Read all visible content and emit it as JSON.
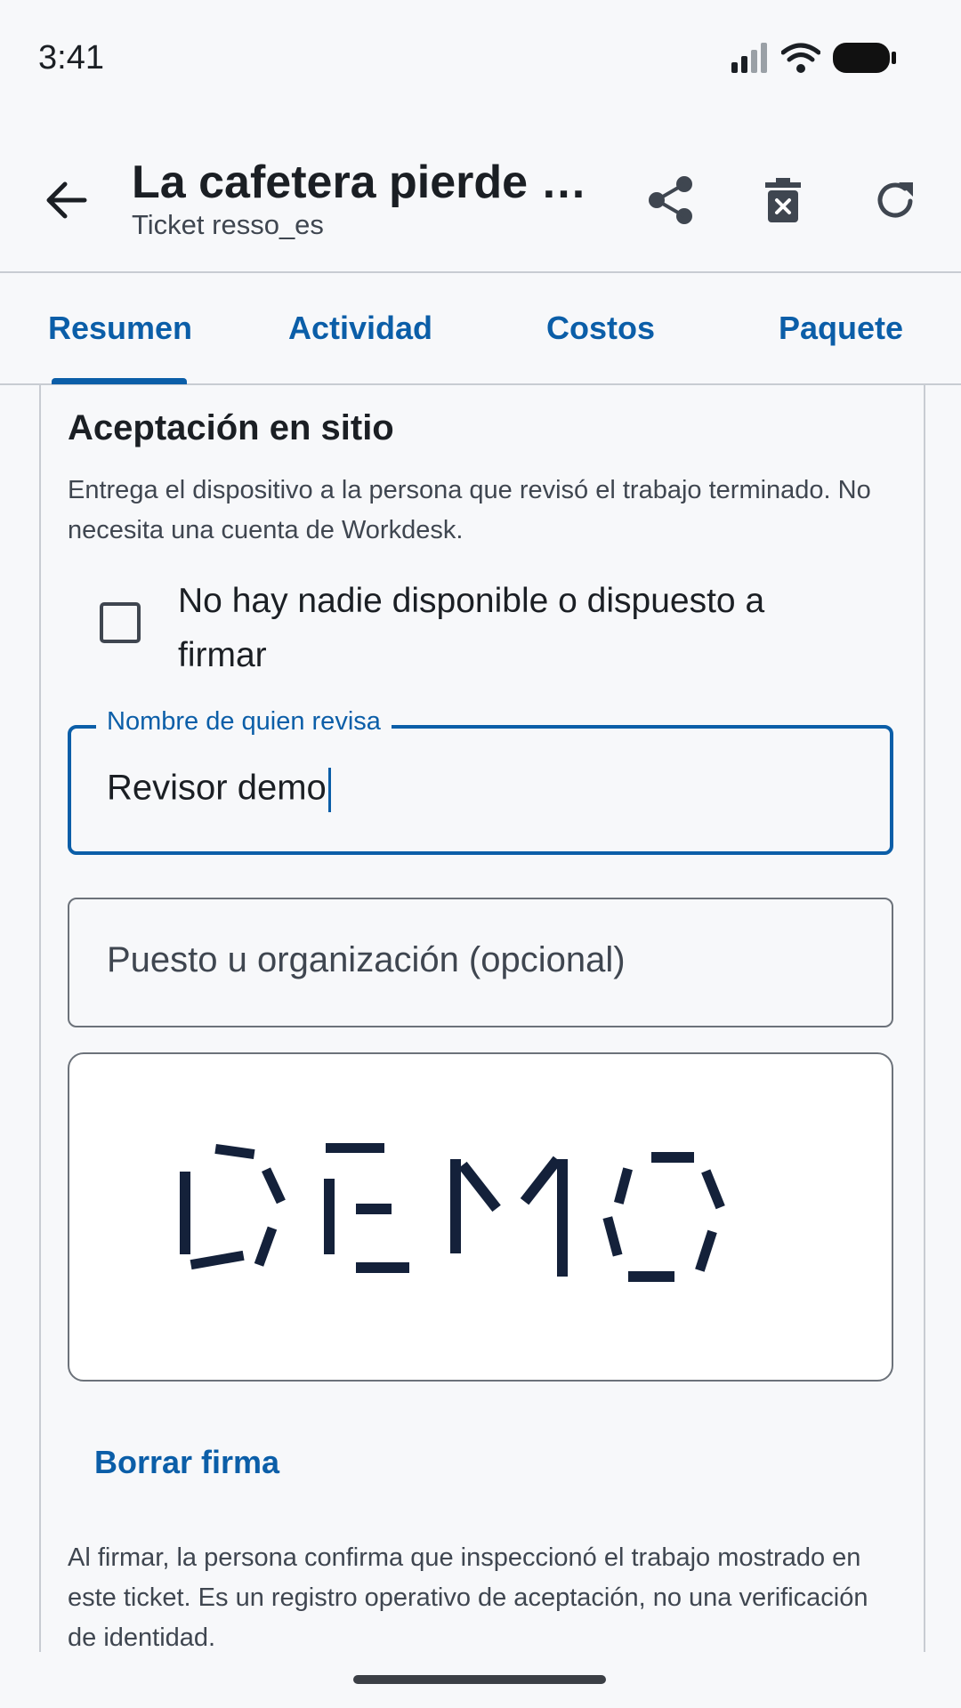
{
  "status_bar": {
    "time": "3:41",
    "icons": [
      "signal-icon",
      "wifi-icon",
      "battery-icon"
    ]
  },
  "app_bar": {
    "title": "La cafetera pierde pr…",
    "subtitle": "Ticket resso_es",
    "actions": [
      "share-icon",
      "delete-icon",
      "refresh-icon"
    ]
  },
  "tabs": [
    {
      "label": "Resumen",
      "selected": true
    },
    {
      "label": "Actividad",
      "selected": false
    },
    {
      "label": "Costos",
      "selected": false
    },
    {
      "label": "Paquete",
      "selected": false
    }
  ],
  "section": {
    "title": "Aceptación en sitio",
    "description": "Entrega el dispositivo a la persona que revisó el trabajo terminado. No necesita una cuenta de Workdesk.",
    "checkbox_label": "No hay nadie disponible o dispuesto a firmar",
    "checkbox_checked": false,
    "reviewer_field": {
      "label": "Nombre de quien revisa",
      "value": "Revisor demo"
    },
    "role_field": {
      "placeholder": "Puesto u organización (opcional)",
      "value": ""
    },
    "signature": {
      "text": "DEMO"
    },
    "clear_label": "Borrar firma",
    "disclaimer": "Al firmar, la persona confirma que inspeccionó el trabajo mostrado en este ticket. Es un registro operativo de aceptación, no una verificación de identidad."
  },
  "colors": {
    "accent": "#0b5ea8",
    "text": "#1b1f24",
    "muted": "#3f4650",
    "background": "#f7f8fa",
    "ink": "#14213a"
  }
}
